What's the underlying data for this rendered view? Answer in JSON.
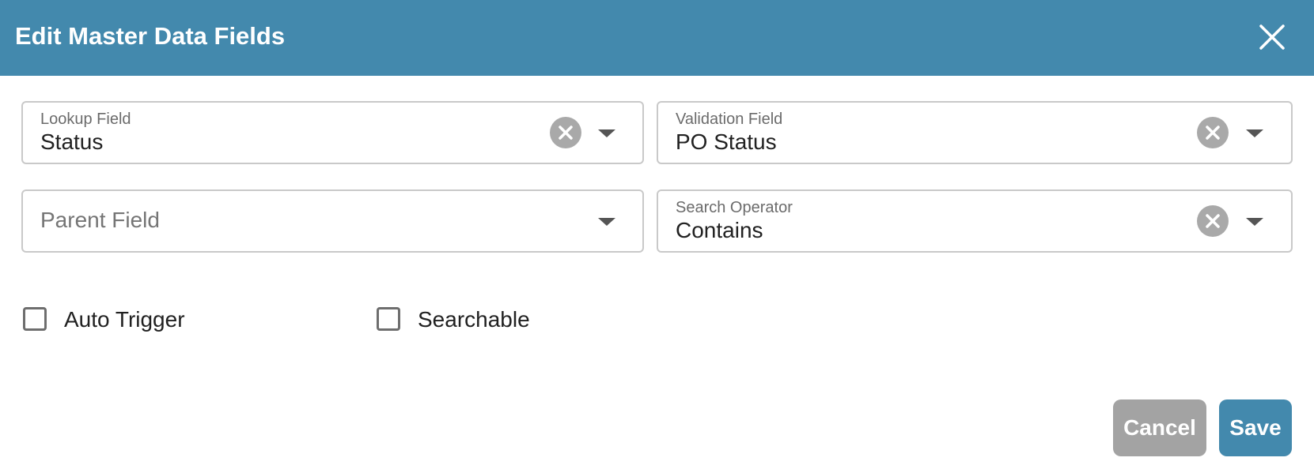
{
  "dialog": {
    "title": "Edit Master Data Fields"
  },
  "fields": {
    "lookup": {
      "label": "Lookup Field",
      "value": "Status"
    },
    "validation": {
      "label": "Validation Field",
      "value": "PO Status"
    },
    "parent": {
      "placeholder": "Parent Field"
    },
    "search_operator": {
      "label": "Search Operator",
      "value": "Contains"
    }
  },
  "checkboxes": {
    "auto_trigger": {
      "label": "Auto Trigger",
      "checked": false
    },
    "searchable": {
      "label": "Searchable",
      "checked": false
    }
  },
  "actions": {
    "cancel_label": "Cancel",
    "save_label": "Save"
  },
  "colors": {
    "header_bg": "#4389ad",
    "primary_button": "#4389ad",
    "secondary_button": "#a3a3a3",
    "clear_icon_bg": "#a9a9a9"
  },
  "icons": {
    "close": "close-icon",
    "clear": "clear-circle-icon",
    "dropdown": "caret-down-icon",
    "checkbox": "checkbox-unchecked-icon"
  }
}
